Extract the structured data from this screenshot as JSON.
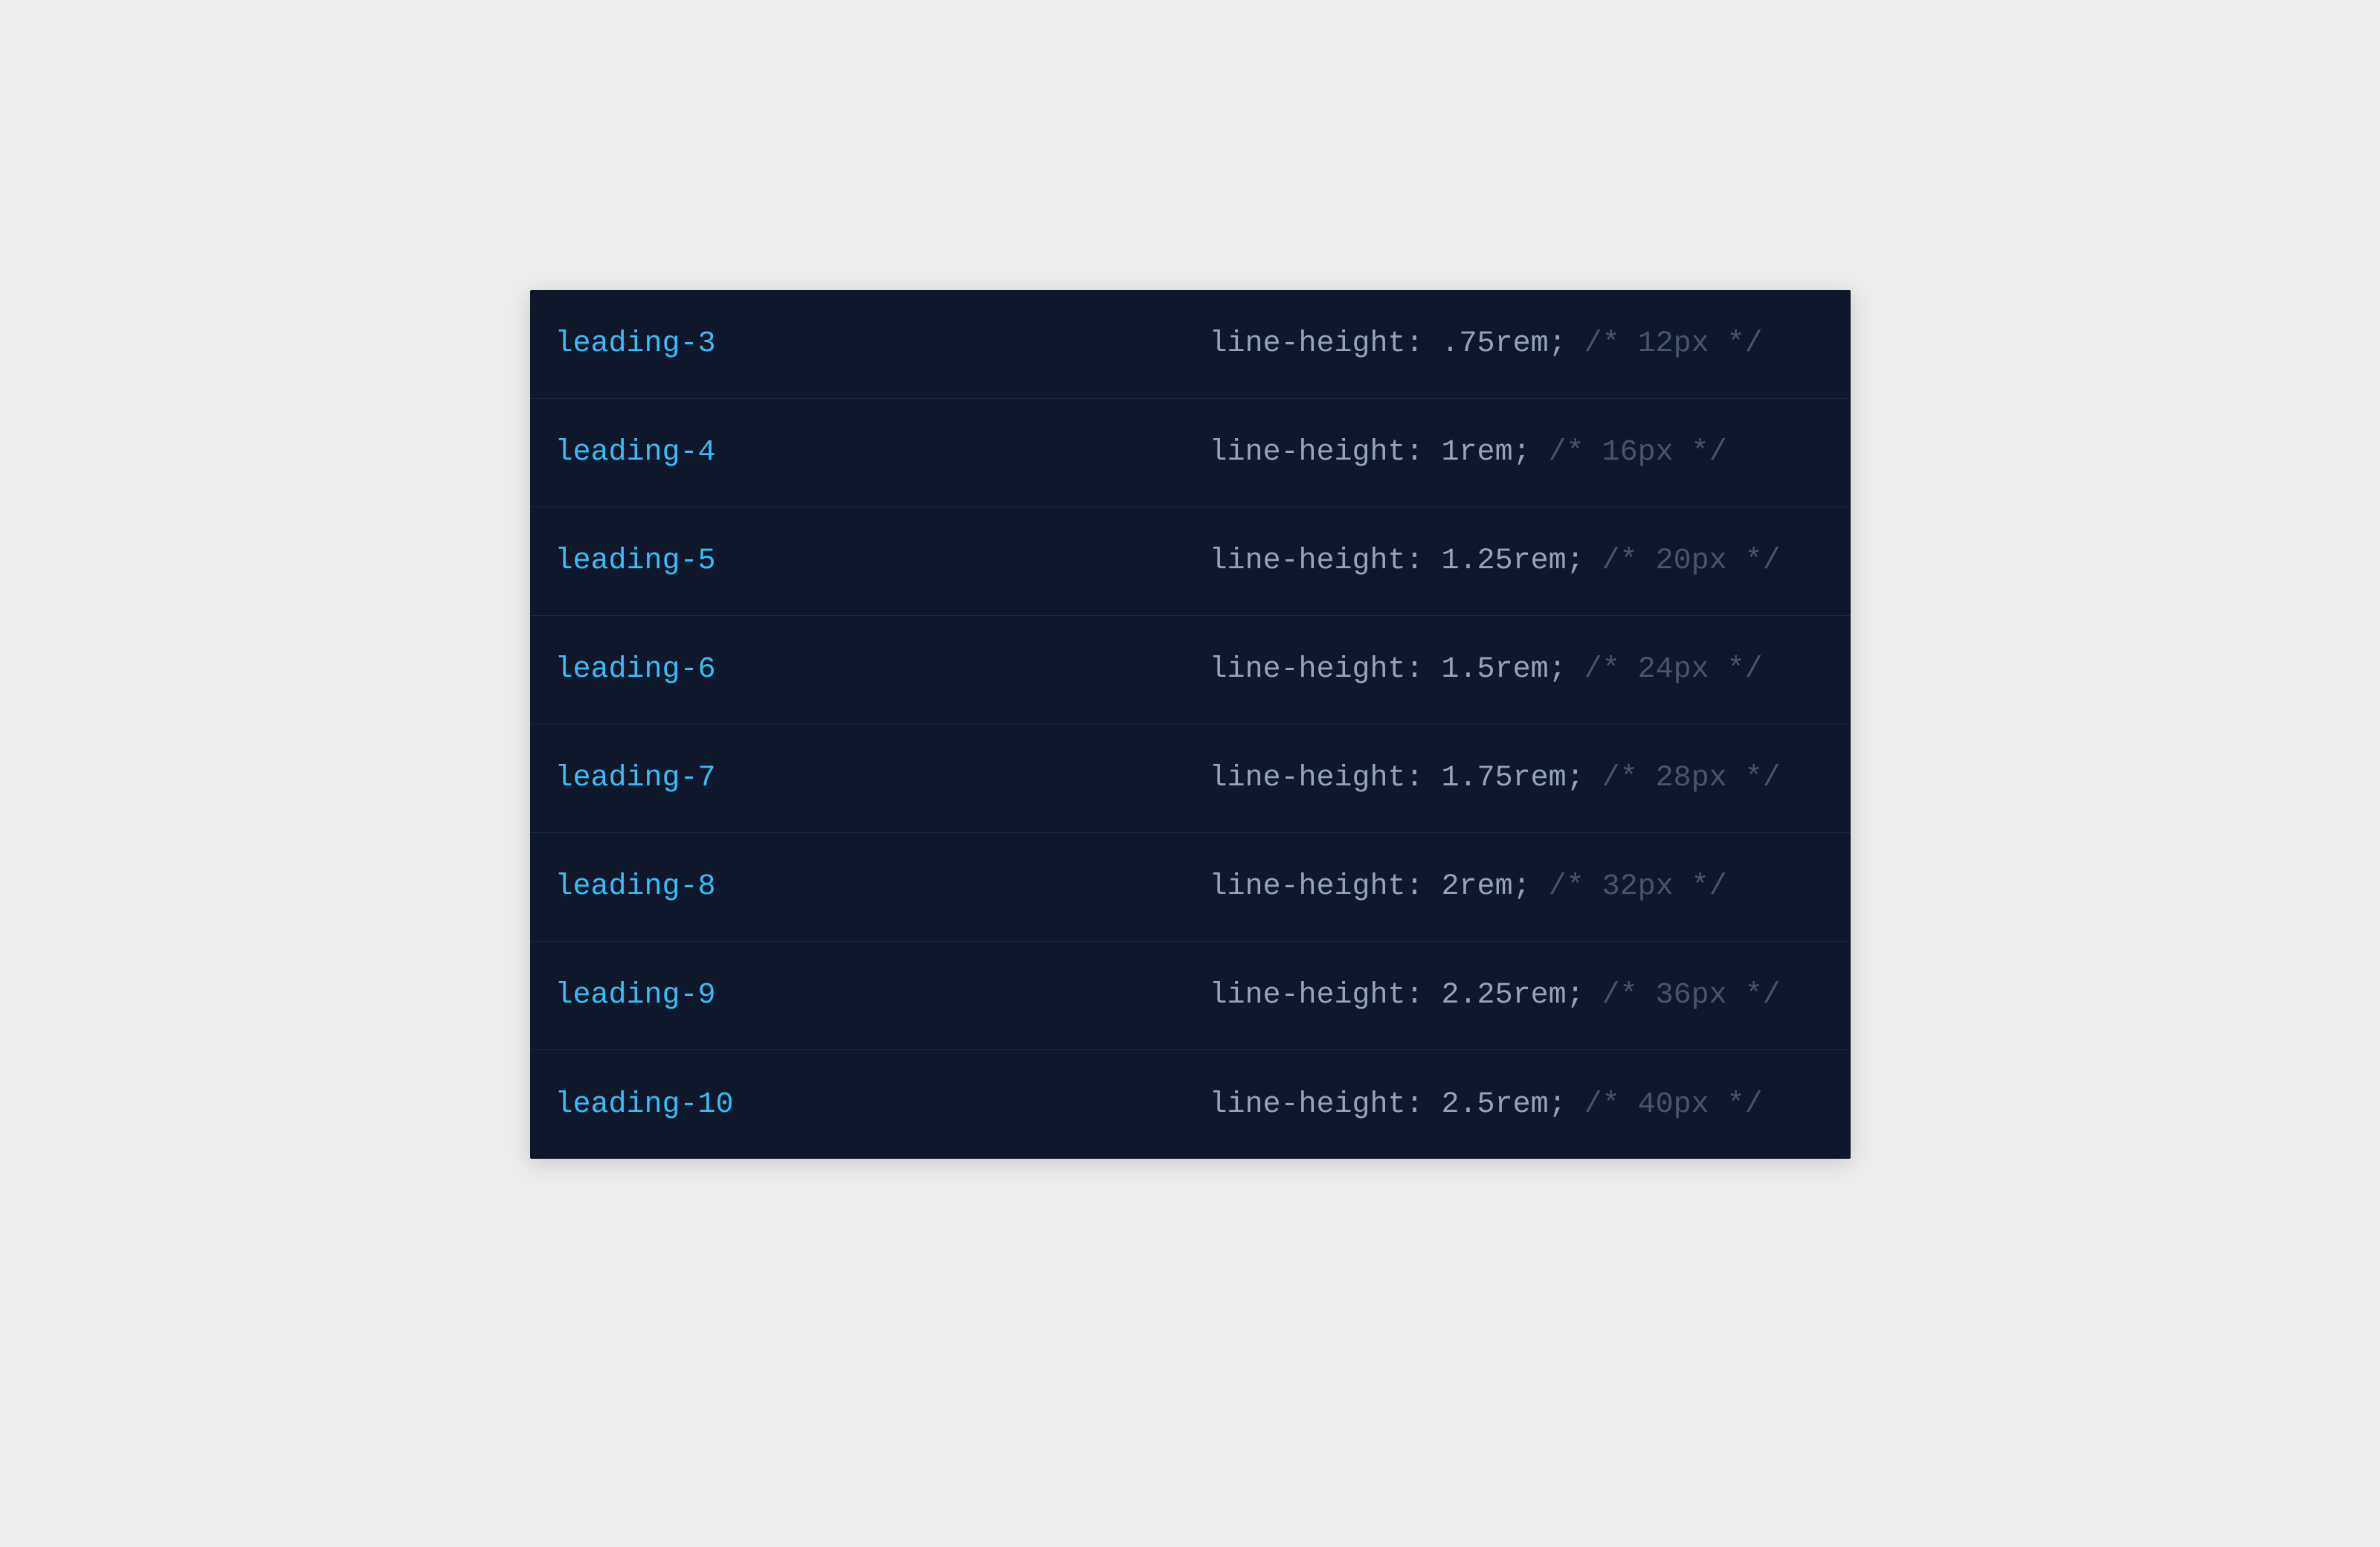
{
  "rows": [
    {
      "class_name": "leading-3",
      "property": "line-height: .75rem;",
      "comment": "/* 12px */"
    },
    {
      "class_name": "leading-4",
      "property": "line-height: 1rem;",
      "comment": "/* 16px */"
    },
    {
      "class_name": "leading-5",
      "property": "line-height: 1.25rem;",
      "comment": "/* 20px */"
    },
    {
      "class_name": "leading-6",
      "property": "line-height: 1.5rem;",
      "comment": "/* 24px */"
    },
    {
      "class_name": "leading-7",
      "property": "line-height: 1.75rem;",
      "comment": "/* 28px */"
    },
    {
      "class_name": "leading-8",
      "property": "line-height: 2rem;",
      "comment": "/* 32px */"
    },
    {
      "class_name": "leading-9",
      "property": "line-height: 2.25rem;",
      "comment": "/* 36px */"
    },
    {
      "class_name": "leading-10",
      "property": "line-height: 2.5rem;",
      "comment": "/* 40px */"
    }
  ]
}
